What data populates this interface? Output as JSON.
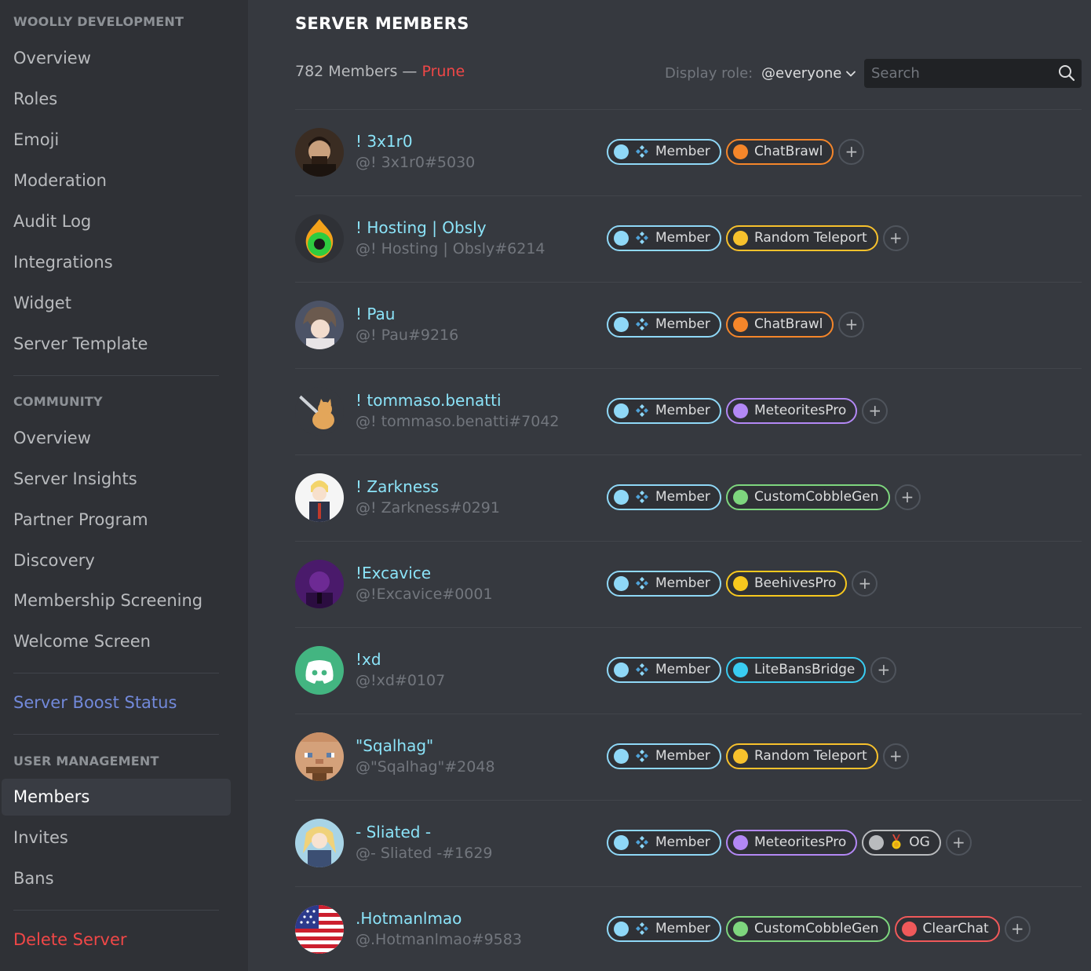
{
  "sidebar": {
    "server_section": "WOOLLY DEVELOPMENT",
    "server_items": [
      "Overview",
      "Roles",
      "Emoji",
      "Moderation",
      "Audit Log",
      "Integrations",
      "Widget",
      "Server Template"
    ],
    "community_section": "COMMUNITY",
    "community_items": [
      "Overview",
      "Server Insights",
      "Partner Program",
      "Discovery",
      "Membership Screening",
      "Welcome Screen"
    ],
    "boost_status": "Server Boost Status",
    "user_section": "USER MANAGEMENT",
    "user_items": [
      "Members",
      "Invites",
      "Bans"
    ],
    "active_item": "Members",
    "delete_server": "Delete Server"
  },
  "header": {
    "title": "SERVER MEMBERS",
    "member_count": "782 Members —",
    "prune": "Prune",
    "display_role_label": "Display role:",
    "display_role_value": "@everyone",
    "search_placeholder": "Search"
  },
  "colors": {
    "accent_blue": "#7289da",
    "danger": "#f04747",
    "username": "#8be3f8"
  },
  "members": [
    {
      "name": "! 3x1r0",
      "tag": "@! 3x1r0#5030",
      "avatar": "portrait",
      "roles": [
        {
          "name": "Member",
          "color": "#8fd8f7",
          "icon": "member-diamonds-icon"
        },
        {
          "name": "ChatBrawl",
          "color": "#f5862a"
        }
      ]
    },
    {
      "name": "! Hosting | Obsly",
      "tag": "@! Hosting | Obsly#6214",
      "avatar": "fire-ring",
      "roles": [
        {
          "name": "Member",
          "color": "#8fd8f7",
          "icon": "member-diamonds-icon"
        },
        {
          "name": "Random Teleport",
          "color": "#f7c12c"
        }
      ]
    },
    {
      "name": "! Pau",
      "tag": "@! Pau#9216",
      "avatar": "anime",
      "roles": [
        {
          "name": "Member",
          "color": "#8fd8f7",
          "icon": "member-diamonds-icon"
        },
        {
          "name": "ChatBrawl",
          "color": "#f5862a"
        }
      ]
    },
    {
      "name": "! tommaso.benatti",
      "tag": "@! tommaso.benatti#7042",
      "avatar": "cat",
      "roles": [
        {
          "name": "Member",
          "color": "#8fd8f7",
          "icon": "member-diamonds-icon"
        },
        {
          "name": "MeteoritesPro",
          "color": "#b388f5"
        }
      ]
    },
    {
      "name": "! Zarkness",
      "tag": "@! Zarkness#0291",
      "avatar": "anime-white",
      "roles": [
        {
          "name": "Member",
          "color": "#8fd8f7",
          "icon": "member-diamonds-icon"
        },
        {
          "name": "CustomCobbleGen",
          "color": "#7ed67e"
        }
      ]
    },
    {
      "name": "!Excavice",
      "tag": "@!Excavice#0001",
      "avatar": "purple",
      "roles": [
        {
          "name": "Member",
          "color": "#8fd8f7",
          "icon": "member-diamonds-icon"
        },
        {
          "name": "BeehivesPro",
          "color": "#f7c81e"
        }
      ]
    },
    {
      "name": "!xd",
      "tag": "@!xd#0107",
      "avatar": "discord-green",
      "roles": [
        {
          "name": "Member",
          "color": "#8fd8f7",
          "icon": "member-diamonds-icon"
        },
        {
          "name": "LiteBansBridge",
          "color": "#39cdf2"
        }
      ]
    },
    {
      "name": "\"Sqalhag\"",
      "tag": "@\"Sqalhag\"#2048",
      "avatar": "pixel-face",
      "roles": [
        {
          "name": "Member",
          "color": "#8fd8f7",
          "icon": "member-diamonds-icon"
        },
        {
          "name": "Random Teleport",
          "color": "#f7c12c"
        }
      ]
    },
    {
      "name": "- Sliated -",
      "tag": "@- Sliated -#1629",
      "avatar": "anime-blonde",
      "roles": [
        {
          "name": "Member",
          "color": "#8fd8f7",
          "icon": "member-diamonds-icon"
        },
        {
          "name": "MeteoritesPro",
          "color": "#b388f5"
        },
        {
          "name": "OG",
          "color": "#b9bbbe",
          "icon": "medal-icon"
        }
      ]
    },
    {
      "name": ".Hotmanlmao",
      "tag": "@.Hotmanlmao#9583",
      "avatar": "us-flag",
      "roles": [
        {
          "name": "Member",
          "color": "#8fd8f7",
          "icon": "member-diamonds-icon"
        },
        {
          "name": "CustomCobbleGen",
          "color": "#7ed67e"
        },
        {
          "name": "ClearChat",
          "color": "#f0595a"
        }
      ]
    }
  ]
}
